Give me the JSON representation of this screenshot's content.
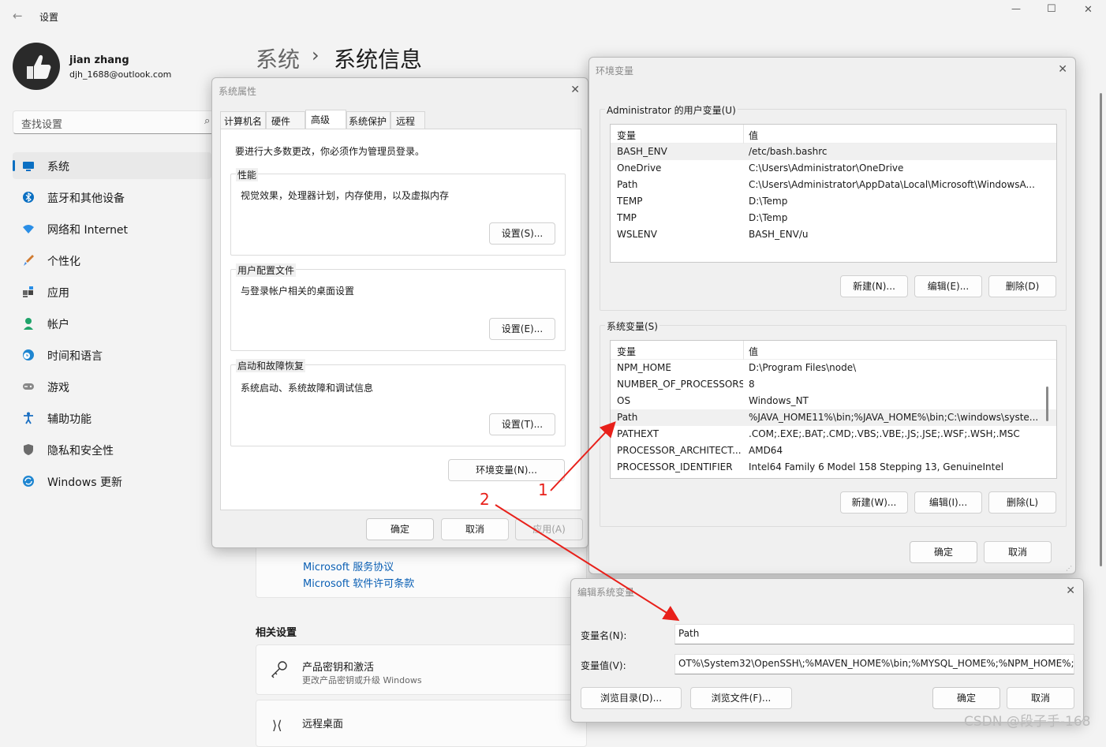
{
  "window": {
    "title": "设置",
    "min": "—",
    "max": "☐",
    "close": "✕"
  },
  "profile": {
    "name": "jian zhang",
    "email": "djh_1688@outlook.com"
  },
  "search": {
    "placeholder": "查找设置"
  },
  "nav": [
    {
      "label": "系统",
      "icon": "monitor-icon",
      "color": "#0a6fc2"
    },
    {
      "label": "蓝牙和其他设备",
      "icon": "bluetooth-icon",
      "color": "#0a6fc2"
    },
    {
      "label": "网络和 Internet",
      "icon": "wifi-icon",
      "color": "#2a8ee6"
    },
    {
      "label": "个性化",
      "icon": "brush-icon",
      "color": "#d07a30"
    },
    {
      "label": "应用",
      "icon": "apps-icon",
      "color": "#555"
    },
    {
      "label": "帐户",
      "icon": "account-icon",
      "color": "#1fa36a"
    },
    {
      "label": "时间和语言",
      "icon": "clock-globe-icon",
      "color": "#1f86d1"
    },
    {
      "label": "游戏",
      "icon": "gamepad-icon",
      "color": "#777"
    },
    {
      "label": "辅助功能",
      "icon": "accessibility-icon",
      "color": "#1a6fc2"
    },
    {
      "label": "隐私和安全性",
      "icon": "shield-icon",
      "color": "#6b6b6b"
    },
    {
      "label": "Windows 更新",
      "icon": "update-icon",
      "color": "#1f86d1"
    }
  ],
  "breadcrumb": {
    "parent": "系统",
    "sep": "›",
    "current": "系统信息"
  },
  "main": {
    "links": [
      "Microsoft 服务协议",
      "Microsoft 软件许可条款"
    ],
    "related_title": "相关设置",
    "related": [
      {
        "title": "产品密钥和激活",
        "sub": "更改产品密钥或升级 Windows"
      },
      {
        "title": "远程桌面",
        "sub": ""
      }
    ]
  },
  "sysprops": {
    "title": "系统属性",
    "tabs": [
      "计算机名",
      "硬件",
      "高级",
      "系统保护",
      "远程"
    ],
    "active_tab": "高级",
    "notice": "要进行大多数更改，你必须作为管理员登录。",
    "groups": [
      {
        "label": "性能",
        "desc": "视觉效果，处理器计划，内存使用，以及虚拟内存",
        "btn": "设置(S)..."
      },
      {
        "label": "用户配置文件",
        "desc": "与登录帐户相关的桌面设置",
        "btn": "设置(E)..."
      },
      {
        "label": "启动和故障恢复",
        "desc": "系统启动、系统故障和调试信息",
        "btn": "设置(T)..."
      }
    ],
    "env_btn": "环境变量(N)...",
    "ok": "确定",
    "cancel": "取消",
    "apply": "应用(A)"
  },
  "envvars": {
    "title": "环境变量",
    "user_label": "Administrator 的用户变量(U)",
    "col_var": "变量",
    "col_val": "值",
    "user_rows": [
      {
        "var": "BASH_ENV",
        "val": "/etc/bash.bashrc"
      },
      {
        "var": "OneDrive",
        "val": "C:\\Users\\Administrator\\OneDrive"
      },
      {
        "var": "Path",
        "val": "C:\\Users\\Administrator\\AppData\\Local\\Microsoft\\WindowsA..."
      },
      {
        "var": "TEMP",
        "val": "D:\\Temp"
      },
      {
        "var": "TMP",
        "val": "D:\\Temp"
      },
      {
        "var": "WSLENV",
        "val": "BASH_ENV/u"
      }
    ],
    "user_btns": [
      "新建(N)...",
      "编辑(E)...",
      "删除(D)"
    ],
    "sys_label": "系统变量(S)",
    "sys_rows": [
      {
        "var": "NPM_HOME",
        "val": "D:\\Program Files\\node\\"
      },
      {
        "var": "NUMBER_OF_PROCESSORS",
        "val": "8"
      },
      {
        "var": "OS",
        "val": "Windows_NT"
      },
      {
        "var": "Path",
        "val": "%JAVA_HOME11%\\bin;%JAVA_HOME%\\bin;C:\\windows\\syste..."
      },
      {
        "var": "PATHEXT",
        "val": ".COM;.EXE;.BAT;.CMD;.VBS;.VBE;.JS;.JSE;.WSF;.WSH;.MSC"
      },
      {
        "var": "PROCESSOR_ARCHITECT...",
        "val": "AMD64"
      },
      {
        "var": "PROCESSOR_IDENTIFIER",
        "val": "Intel64 Family 6 Model 158 Stepping 13, GenuineIntel"
      }
    ],
    "sys_btns": [
      "新建(W)...",
      "编辑(I)...",
      "删除(L)"
    ],
    "ok": "确定",
    "cancel": "取消"
  },
  "editvar": {
    "title": "编辑系统变量",
    "name_label": "变量名(N):",
    "name_value": "Path",
    "value_label": "变量值(V):",
    "value_value": "OT%\\System32\\OpenSSH\\;%MAVEN_HOME%\\bin;%MYSQL_HOME%;%NPM_HOME%;",
    "browse_dir": "浏览目录(D)...",
    "browse_file": "浏览文件(F)...",
    "ok": "确定",
    "cancel": "取消"
  },
  "annotations": {
    "step1": "1",
    "step2": "2",
    "arrow_color": "#e8201a"
  },
  "watermark": "CSDN @段子手-168"
}
